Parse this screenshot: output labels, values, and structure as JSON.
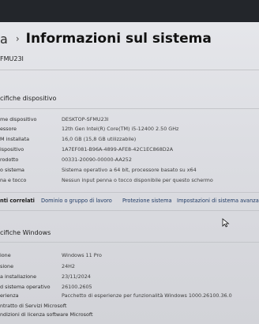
{
  "header": {
    "breadcrumb_fragment": "a",
    "separator": "›",
    "title": "Informazioni sul sistema"
  },
  "device_name": "FMU23I",
  "device_specs": {
    "heading": "cifiche dispositivo",
    "rows": [
      {
        "label": "me dispositivo",
        "value": "DESKTOP-SFMU23I"
      },
      {
        "label": "essore",
        "value": "12th Gen Intel(R) Core(TM) i5-12400   2.50 GHz"
      },
      {
        "label": "M installata",
        "value": "16,0 GB (15,8 GB utilizzabile)"
      },
      {
        "label": "ispositivo",
        "value": "1A7EF081-B96A-4899-AFE8-42C1EC868D2A"
      },
      {
        "label": "rodotto",
        "value": "00331-20090-00000-AA252"
      },
      {
        "label": "o sistema",
        "value": "Sistema operativo a 64 bit, processore basato su x64"
      },
      {
        "label": "na e tocco",
        "value": "Nessun input penna o tocco disponibile per questo schermo"
      }
    ]
  },
  "related_links": {
    "label": "nti correlati",
    "items": [
      "Dominio o gruppo di lavoro",
      "Protezione sistema",
      "Impostazioni di sistema avanzate"
    ]
  },
  "windows_specs": {
    "heading": "cifiche Windows",
    "rows": [
      {
        "label": "ione",
        "value": "Windows 11 Pro"
      },
      {
        "label": "sione",
        "value": "24H2"
      },
      {
        "label": "a installazione",
        "value": "23/11/2024"
      },
      {
        "label": "d sistema operativo",
        "value": "26100.2605"
      },
      {
        "label": "erienza",
        "value": "Pacchetto di esperienze per funzionalità Windows 1000.26100.36.0"
      }
    ],
    "footer": [
      "ntratto di Servizi Microsoft",
      "ndizioni di licenza software Microsoft"
    ]
  }
}
